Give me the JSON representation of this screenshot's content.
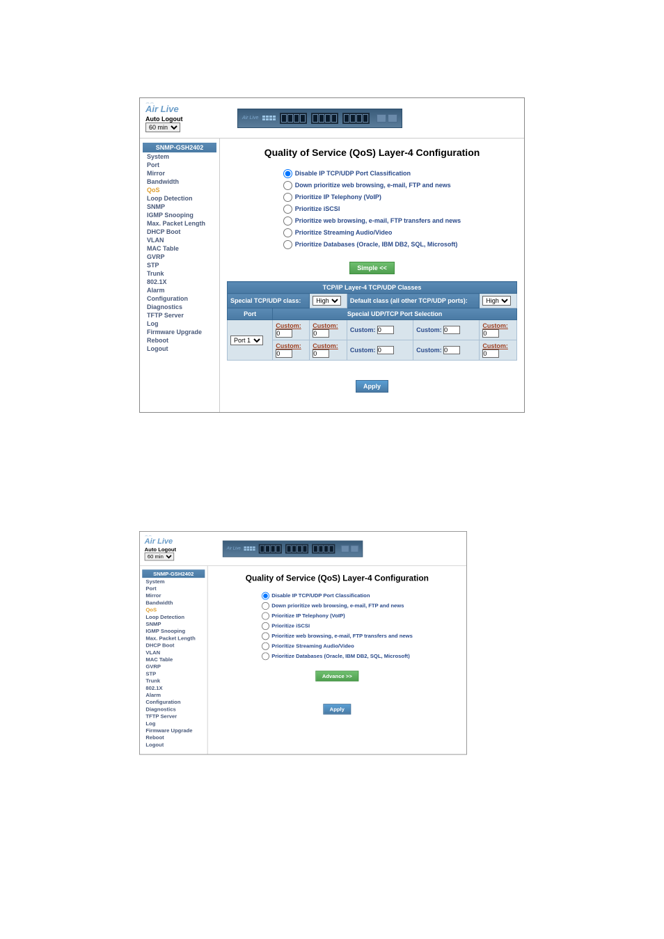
{
  "logo_name": "Air Live",
  "auto_logout_label": "Auto Logout",
  "auto_logout_value": "60 min",
  "sidebar_header": "SNMP-GSH2402",
  "sidebar_items": [
    {
      "label": "System",
      "active": false
    },
    {
      "label": "Port",
      "active": false
    },
    {
      "label": "Mirror",
      "active": false
    },
    {
      "label": "Bandwidth",
      "active": false
    },
    {
      "label": "QoS",
      "active": true
    },
    {
      "label": "Loop Detection",
      "active": false
    },
    {
      "label": "SNMP",
      "active": false
    },
    {
      "label": "IGMP Snooping",
      "active": false
    },
    {
      "label": "Max. Packet Length",
      "active": false
    },
    {
      "label": "DHCP Boot",
      "active": false
    },
    {
      "label": "VLAN",
      "active": false
    },
    {
      "label": "MAC Table",
      "active": false
    },
    {
      "label": "GVRP",
      "active": false
    },
    {
      "label": "STP",
      "active": false
    },
    {
      "label": "Trunk",
      "active": false
    },
    {
      "label": "802.1X",
      "active": false
    },
    {
      "label": "Alarm",
      "active": false
    },
    {
      "label": "Configuration",
      "active": false
    },
    {
      "label": "Diagnostics",
      "active": false
    },
    {
      "label": "TFTP Server",
      "active": false
    },
    {
      "label": "Log",
      "active": false
    },
    {
      "label": "Firmware Upgrade",
      "active": false
    },
    {
      "label": "Reboot",
      "active": false
    },
    {
      "label": "Logout",
      "active": false
    }
  ],
  "page_title": "Quality of Service (QoS) Layer-4 Configuration",
  "radio_options": [
    {
      "label": "Disable IP TCP/UDP Port Classification",
      "checked": true
    },
    {
      "label": "Down prioritize web browsing, e-mail, FTP and news",
      "checked": false
    },
    {
      "label": "Prioritize IP Telephony (VoIP)",
      "checked": false
    },
    {
      "label": "Prioritize iSCSI",
      "checked": false
    },
    {
      "label": "Prioritize web browsing, e-mail, FTP transfers and news",
      "checked": false
    },
    {
      "label": "Prioritize Streaming Audio/Video",
      "checked": false
    },
    {
      "label": "Prioritize Databases (Oracle, IBM DB2, SQL, Microsoft)",
      "checked": false
    }
  ],
  "simple_btn": "Simple <<",
  "advance_btn": "Advance >>",
  "apply_btn": "Apply",
  "table_header_main": "TCP/IP Layer-4 TCP/UDP Classes",
  "special_class_label": "Special TCP/UDP class:",
  "special_class_value": "High",
  "default_class_label": "Default class (all other TCP/UDP ports):",
  "default_class_value": "High",
  "port_header": "Port",
  "special_sel_header": "Special UDP/TCP Port Selection",
  "port_value": "Port 1",
  "custom_label": "Custom:",
  "custom_value": "0"
}
